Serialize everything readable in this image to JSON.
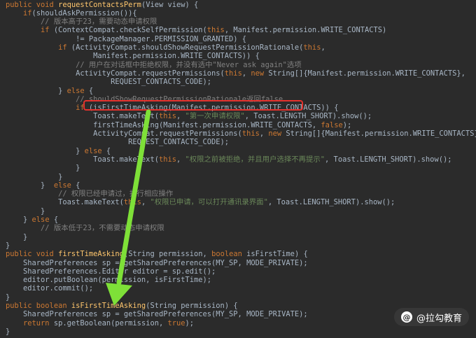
{
  "code_lines": [
    [
      [
        "kw",
        "public void "
      ],
      [
        "fn",
        "requestContactsPerm"
      ],
      [
        "p",
        "("
      ],
      [
        "ty",
        "View view"
      ],
      [
        "p",
        ") {"
      ]
    ],
    [
      [
        "p",
        "    "
      ],
      [
        "kw",
        "if"
      ],
      [
        "p",
        "(shouldAskPermission()){"
      ]
    ],
    [
      [
        "p",
        "        "
      ],
      [
        "cm",
        "// 版本高于23，需要动态申请权限"
      ]
    ],
    [
      [
        "p",
        "        "
      ],
      [
        "kw",
        "if "
      ],
      [
        "p",
        "(ContextCompat.checkSelfPermission("
      ],
      [
        "kw",
        "this"
      ],
      [
        "p",
        ", Manifest.permission.WRITE_CONTACTS)"
      ]
    ],
    [
      [
        "p",
        "                != PackageManager.PERMISSION_GRANTED) {"
      ]
    ],
    [
      [
        "p",
        "            "
      ],
      [
        "kw",
        "if "
      ],
      [
        "p",
        "(ActivityCompat.shouldShowRequestPermissionRationale("
      ],
      [
        "kw",
        "this"
      ],
      [
        "p",
        ","
      ]
    ],
    [
      [
        "p",
        "                    Manifest.permission.WRITE_CONTACTS)) {"
      ]
    ],
    [
      [
        "p",
        "                "
      ],
      [
        "cm",
        "// 用户在对话框中拒绝权限，并没有选中\"Never ask again\"选项"
      ]
    ],
    [
      [
        "p",
        "                ActivityCompat.requestPermissions("
      ],
      [
        "kw",
        "this"
      ],
      [
        "p",
        ", "
      ],
      [
        "kw",
        "new "
      ],
      [
        "p",
        "String[]{Manifest.permission.WRITE_CONTACTS},"
      ]
    ],
    [
      [
        "p",
        "                        REQUEST_CONTACTS_CODE);"
      ]
    ],
    [
      [
        "p",
        "            } "
      ],
      [
        "kw",
        "else "
      ],
      [
        "p",
        "{"
      ]
    ],
    [
      [
        "p",
        "                "
      ],
      [
        "cm",
        "// shouldShowRequestPermissionRationale返回false"
      ]
    ],
    [
      [
        "p",
        "                "
      ],
      [
        "kw",
        "if "
      ],
      [
        "p",
        "(isFirstTimeAsking(Manifest.permission.WRITE_CONTACTS)) {"
      ]
    ],
    [
      [
        "p",
        "                    Toast.makeText("
      ],
      [
        "kw",
        "this"
      ],
      [
        "p",
        ", "
      ],
      [
        "str",
        "\"第一次申请权限\""
      ],
      [
        "p",
        ", Toast.LENGTH_SHORT).show();"
      ]
    ],
    [
      [
        "p",
        "                    firstTimeAsking(Manifest.permission.WRITE_CONTACTS, "
      ],
      [
        "kw",
        "false"
      ],
      [
        "p",
        ");"
      ]
    ],
    [
      [
        "p",
        "                    ActivityCompat.requestPermissions("
      ],
      [
        "kw",
        "this"
      ],
      [
        "p",
        ", "
      ],
      [
        "kw",
        "new "
      ],
      [
        "p",
        "String[]{Manifest.permission.WRITE_CONTACTS},"
      ]
    ],
    [
      [
        "p",
        "                            REQUEST_CONTACTS_CODE);"
      ]
    ],
    [
      [
        "p",
        "                } "
      ],
      [
        "kw",
        "else "
      ],
      [
        "p",
        "{"
      ]
    ],
    [
      [
        "p",
        "                    Toast.makeText("
      ],
      [
        "kw",
        "this"
      ],
      [
        "p",
        ", "
      ],
      [
        "str",
        "\"权限之前被拒绝，并且用户选择不再提示\""
      ],
      [
        "p",
        ", Toast.LENGTH_SHORT).show();"
      ]
    ],
    [
      [
        "p",
        "                }"
      ]
    ],
    [
      [
        "p",
        "            }"
      ]
    ],
    [
      [
        "p",
        "        }  "
      ],
      [
        "kw",
        "else "
      ],
      [
        "p",
        "{"
      ]
    ],
    [
      [
        "p",
        "            "
      ],
      [
        "cm",
        "// 权限已经申请过，执行相应操作"
      ]
    ],
    [
      [
        "p",
        "            Toast.makeText("
      ],
      [
        "kw",
        "this"
      ],
      [
        "p",
        ", "
      ],
      [
        "str",
        "\"权限已申请，可以打开通讯录界面\""
      ],
      [
        "p",
        ", Toast.LENGTH_SHORT).show();"
      ]
    ],
    [
      [
        "p",
        "        }"
      ]
    ],
    [
      [
        "p",
        "    } "
      ],
      [
        "kw",
        "else "
      ],
      [
        "p",
        "{"
      ]
    ],
    [
      [
        "p",
        "        "
      ],
      [
        "cm",
        "// 版本低于23，不需要动态申请权限"
      ]
    ],
    [
      [
        "p",
        "    }"
      ]
    ],
    [
      [
        "p",
        "}"
      ]
    ],
    [
      [
        "kw",
        "public void "
      ],
      [
        "fn",
        "firstTimeAsking"
      ],
      [
        "p",
        "("
      ],
      [
        "ty",
        "String permission"
      ],
      [
        "p",
        ", "
      ],
      [
        "kw",
        "boolean "
      ],
      [
        "ty",
        "isFirstTime"
      ],
      [
        "p",
        ") {"
      ]
    ],
    [
      [
        "p",
        "    SharedPreferences sp = getSharedPreferences(MY_SP, MODE_PRIVATE);"
      ]
    ],
    [
      [
        "p",
        "    SharedPreferences.Editor editor = sp.edit();"
      ]
    ],
    [
      [
        "p",
        "    editor.putBoolean(permission, isFirstTime);"
      ]
    ],
    [
      [
        "p",
        "    editor.commit();"
      ]
    ],
    [
      [
        "p",
        "}"
      ]
    ],
    [
      [
        "kw",
        "public boolean "
      ],
      [
        "fn",
        "isFirstTimeAsking"
      ],
      [
        "p",
        "("
      ],
      [
        "ty",
        "String permission"
      ],
      [
        "p",
        ") {"
      ]
    ],
    [
      [
        "p",
        "    SharedPreferences sp = getSharedPreferences(MY_SP, MODE_PRIVATE);"
      ]
    ],
    [
      [
        "p",
        "    "
      ],
      [
        "kw",
        "return "
      ],
      [
        "p",
        "sp.getBoolean(permission, "
      ],
      [
        "kw",
        "true"
      ],
      [
        "p",
        ");"
      ]
    ],
    [
      [
        "p",
        "}"
      ]
    ]
  ],
  "colors": {
    "background": "#2b2b2b",
    "keyword": "#cc7832",
    "function": "#ffc66d",
    "string": "#6a8759",
    "comment": "#808080",
    "plain": "#a9b7c6",
    "highlight_box": "#e5322d",
    "arrow": "#7ee038"
  },
  "watermark": {
    "icon": "lagou-logo-icon",
    "text": "@拉勾教育"
  }
}
